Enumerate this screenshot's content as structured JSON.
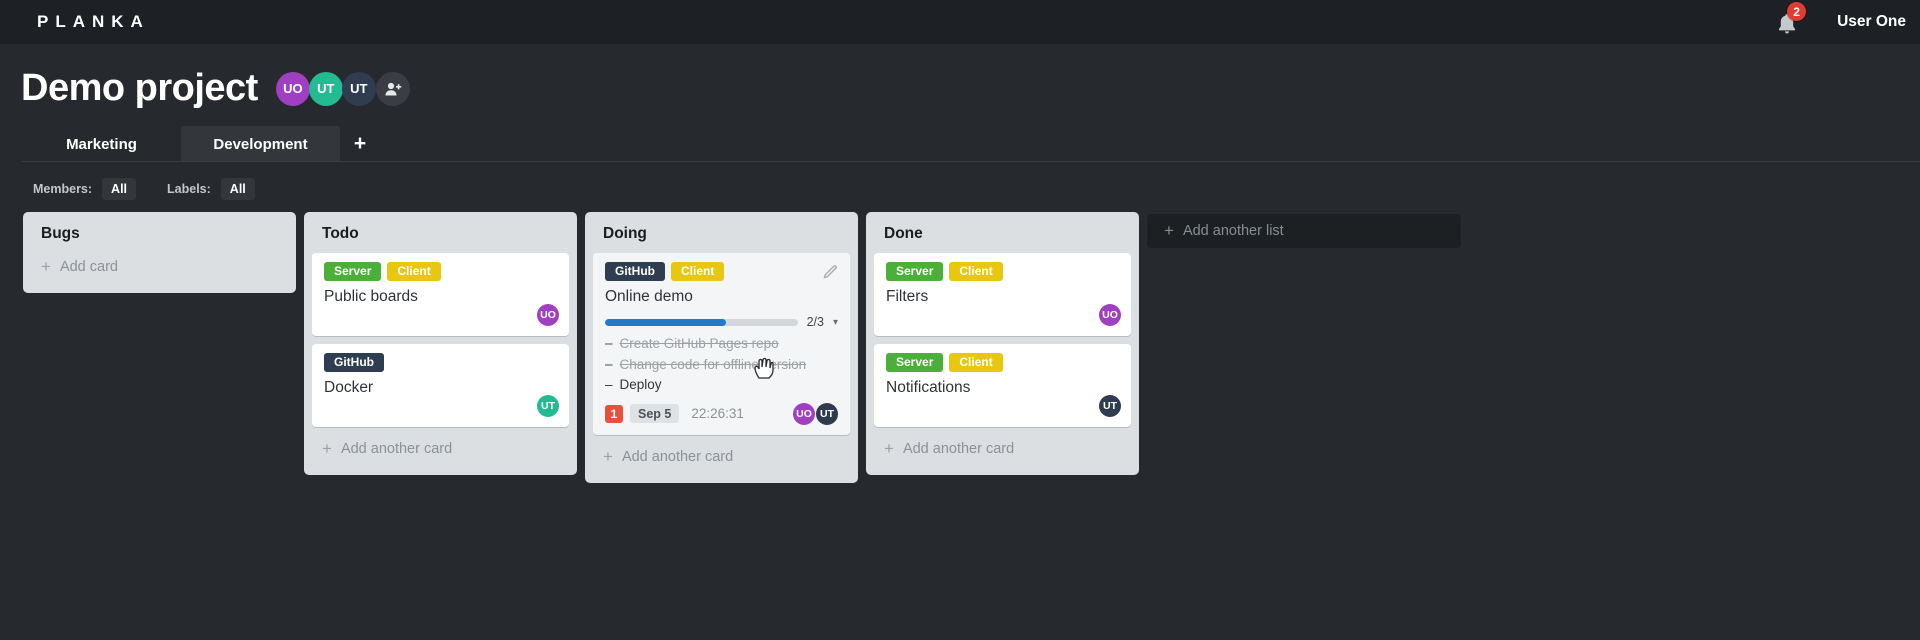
{
  "ui": {
    "plus_icon": "+",
    "caret_down": "▾",
    "task_dash": "–"
  },
  "colors": {
    "topbar_bg": "#1d2024",
    "page_bg": "#26292e",
    "list_bg": "#dcdfe2",
    "label_green": "#4caf39",
    "label_yellow": "#e9c711",
    "label_dark_navy": "#2e3e50",
    "avatar_purple": "#a03fc2",
    "avatar_teal": "#23bb92",
    "avatar_navy": "#303c4f",
    "progress_blue": "#2179c8",
    "card_count_red": "#e8503e",
    "notification_red": "#e03c31"
  },
  "topbar": {
    "logo": "PLANKA",
    "notification_count": "2",
    "user_name": "User One"
  },
  "project": {
    "title": "Demo project",
    "members": [
      {
        "initials": "UO"
      },
      {
        "initials": "UT"
      },
      {
        "initials": "UT"
      }
    ]
  },
  "tabs": {
    "items": [
      {
        "label": "Marketing",
        "active": false
      },
      {
        "label": "Development",
        "active": true
      }
    ],
    "add_button": "+"
  },
  "filters": {
    "members_label": "Members:",
    "members_value": "All",
    "labels_label": "Labels:",
    "labels_value": "All"
  },
  "board": {
    "add_list_label": "Add another list",
    "lists": [
      {
        "title": "Bugs",
        "add_card_label": "Add card",
        "cards": []
      },
      {
        "title": "Todo",
        "add_card_label": "Add another card",
        "cards": [
          {
            "title": "Public boards",
            "labels": [
              {
                "text": "Server"
              },
              {
                "text": "Client"
              }
            ],
            "member": "UO"
          },
          {
            "title": "Docker",
            "labels": [
              {
                "text": "GitHub"
              }
            ],
            "member": "UT"
          }
        ]
      },
      {
        "title": "Doing",
        "add_card_label": "Add another card",
        "cards": [
          {
            "title": "Online demo",
            "labels": [
              {
                "text": "GitHub"
              },
              {
                "text": "Client"
              }
            ],
            "progress": {
              "completed": 2,
              "total": 3,
              "label": "2/3",
              "fill_style": "width:63%"
            },
            "tasks": [
              {
                "text": "Create GitHub Pages repo",
                "done": true
              },
              {
                "text": "Change code for offline version",
                "done": true
              },
              {
                "text": "Deploy",
                "done": false
              }
            ],
            "notification_count": "1",
            "due_date": "Sep 5",
            "timer": "22:26:31",
            "members": [
              "UO",
              "UT"
            ]
          }
        ]
      },
      {
        "title": "Done",
        "add_card_label": "Add another card",
        "cards": [
          {
            "title": "Filters",
            "labels": [
              {
                "text": "Server"
              },
              {
                "text": "Client"
              }
            ],
            "member": "UO"
          },
          {
            "title": "Notifications",
            "labels": [
              {
                "text": "Server"
              },
              {
                "text": "Client"
              }
            ],
            "member": "UT"
          }
        ]
      }
    ]
  }
}
